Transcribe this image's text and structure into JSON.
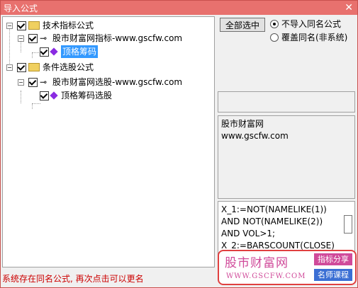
{
  "window": {
    "title": "导入公式",
    "close_glyph": "✕"
  },
  "tree": {
    "groups": [
      {
        "label": "技术指标公式",
        "child": {
          "label": "股市财富网指标-www.gscfw.com",
          "leaf": "顶格筹码"
        }
      },
      {
        "label": "条件选股公式",
        "child": {
          "label": "股市财富网选股-www.gscfw.com",
          "leaf": "顶格筹码选股"
        }
      }
    ],
    "expander_glyph": "−",
    "key_glyph": "⊸"
  },
  "controls": {
    "select_all": "全部选中",
    "radio_options": [
      {
        "label": "不导入同名公式",
        "selected": true
      },
      {
        "label": "覆盖同名(非系统)",
        "selected": false
      }
    ]
  },
  "info": {
    "lines": [
      "股市财富网",
      "www.gscfw.com"
    ]
  },
  "code": {
    "lines": [
      "X_1:=NOT(NAMELIKE(1))",
      "AND NOT(NAMELIKE(2))",
      "AND VOL>1;",
      "X_2:=BARSCOUNT(CLOSE)"
    ]
  },
  "status": "系统存在同名公式, 再次点击可以更名",
  "watermark": {
    "brand": "股市财富网",
    "url": "WWW.GSCFW.COM",
    "tag1": "指标分享",
    "tag2": "名师课程"
  },
  "colors": {
    "title_bar": "#e8716e",
    "selection": "#3399ff",
    "status_text": "#cc0000",
    "gem": "#8a2be2"
  }
}
